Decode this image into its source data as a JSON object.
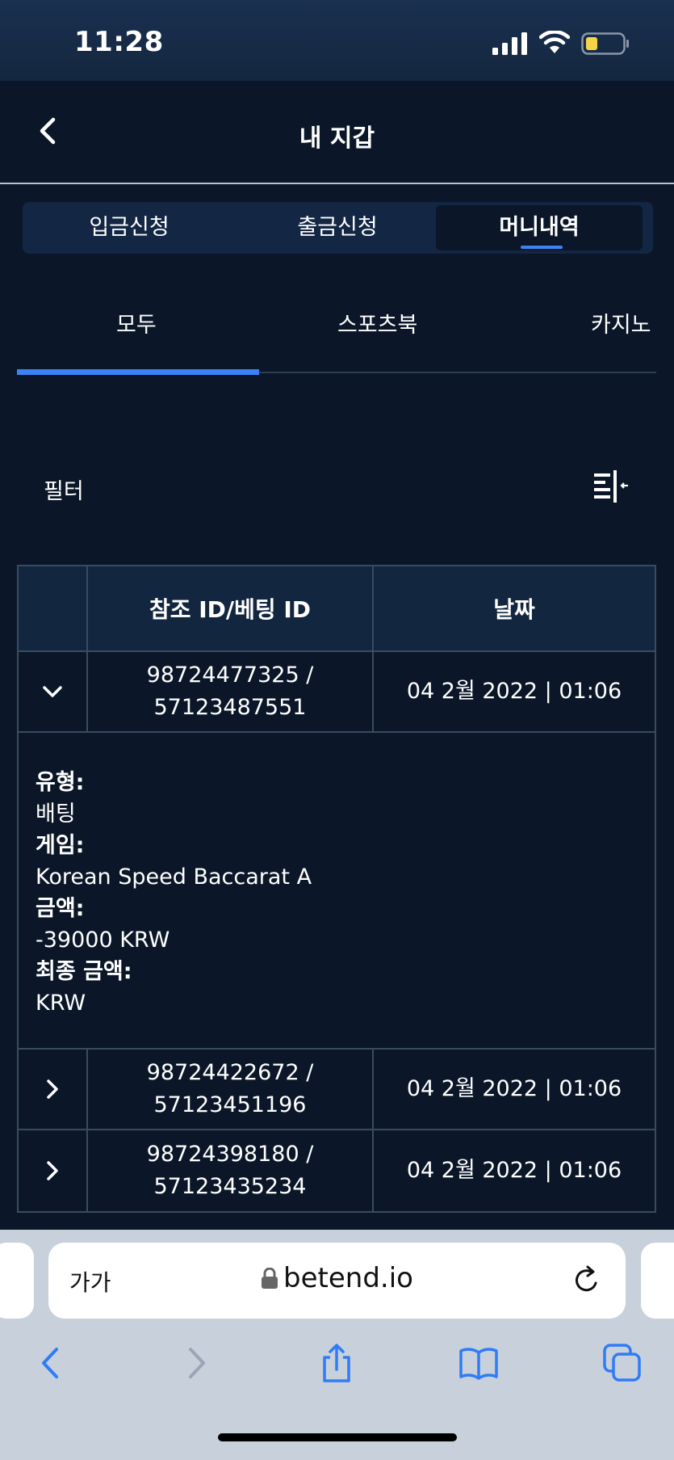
{
  "status_bar": {
    "time": "11:28"
  },
  "header": {
    "title": "내 지갑"
  },
  "main_tabs": [
    {
      "label": "입금신청"
    },
    {
      "label": "출금신청"
    },
    {
      "label": "머니내역"
    }
  ],
  "sub_tabs": [
    {
      "label": "모두"
    },
    {
      "label": "스포츠북"
    },
    {
      "label": "카지노"
    }
  ],
  "filter": {
    "label": "필터"
  },
  "table": {
    "headers": {
      "col2": "참조 ID/베팅 ID",
      "col3": "날짜"
    },
    "rows": [
      {
        "id": "98724477325 /\n57123487551",
        "date": "04 2월 2022 | 01:06",
        "expanded": true
      },
      {
        "id": "98724422672 /\n57123451196",
        "date": "04 2월 2022 | 01:06",
        "expanded": false
      },
      {
        "id": "98724398180 /\n57123435234",
        "date": "04 2월 2022 | 01:06",
        "expanded": false
      }
    ],
    "details": {
      "type_label": "유형:",
      "type_value": "배팅",
      "game_label": "게임:",
      "game_value": "Korean Speed Baccarat A",
      "amount_label": "금액:",
      "amount_value": "-39000 KRW",
      "final_label": "최종 금액:",
      "final_value": "KRW"
    }
  },
  "browser": {
    "aa_label": "가가",
    "url": "betend.io"
  },
  "colors": {
    "background": "#0b1728",
    "accent": "#3b82f6",
    "table_header": "#13263f"
  }
}
